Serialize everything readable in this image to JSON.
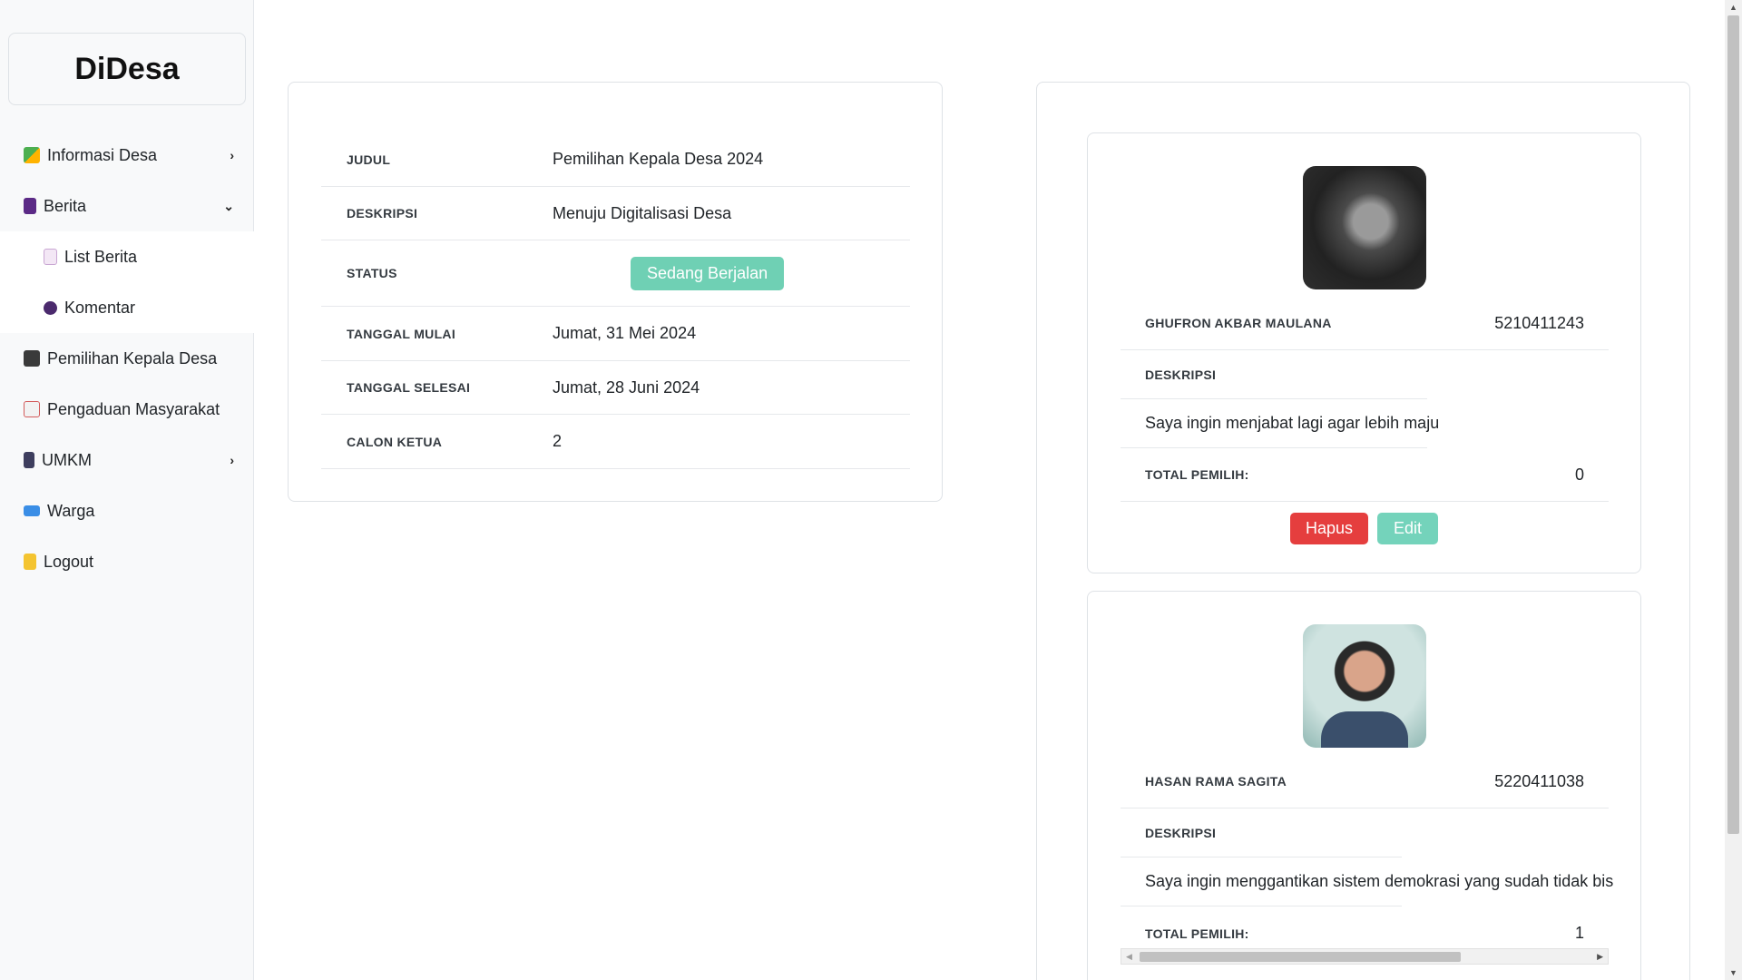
{
  "brand": "DiDesa",
  "sidebar": {
    "items": [
      {
        "label": "Informasi Desa",
        "icon": "map-icon",
        "chevron": "›"
      },
      {
        "label": "Berita",
        "icon": "book-icon",
        "chevron": "⌄"
      },
      {
        "label": "List Berita",
        "icon": "page-icon"
      },
      {
        "label": "Komentar",
        "icon": "speech-icon"
      },
      {
        "label": "Pemilihan Kepala Desa",
        "icon": "clapper-icon"
      },
      {
        "label": "Pengaduan Masyarakat",
        "icon": "memo-icon"
      },
      {
        "label": "UMKM",
        "icon": "phone-icon",
        "chevron": "›"
      },
      {
        "label": "Warga",
        "icon": "id-card-icon"
      },
      {
        "label": "Logout",
        "icon": "lock-icon"
      }
    ]
  },
  "detail": {
    "judul_label": "JUDUL",
    "judul": "Pemilihan Kepala Desa 2024",
    "deskripsi_label": "DESKRIPSI",
    "deskripsi": "Menuju Digitalisasi Desa",
    "status_label": "STATUS",
    "status": "Sedang Berjalan",
    "mulai_label": "TANGGAL MULAI",
    "mulai": "Jumat, 31 Mei 2024",
    "selesai_label": "TANGGAL SELESAI",
    "selesai": "Jumat, 28 Juni 2024",
    "calon_label": "CALON KETUA",
    "calon": "2"
  },
  "candidates": [
    {
      "name": "GHUFRON AKBAR MAULANA",
      "nim": "5210411243",
      "desc_label": "DESKRIPSI",
      "desc": "Saya ingin menjabat lagi agar lebih maju",
      "total_label": "TOTAL PEMILIH:",
      "total": "0",
      "delete_label": "Hapus",
      "edit_label": "Edit"
    },
    {
      "name": "HASAN RAMA SAGITA",
      "nim": "5220411038",
      "desc_label": "DESKRIPSI",
      "desc": "Saya ingin menggantikan sistem demokrasi yang sudah tidak bis",
      "total_label": "TOTAL PEMILIH:",
      "total": "1"
    }
  ]
}
